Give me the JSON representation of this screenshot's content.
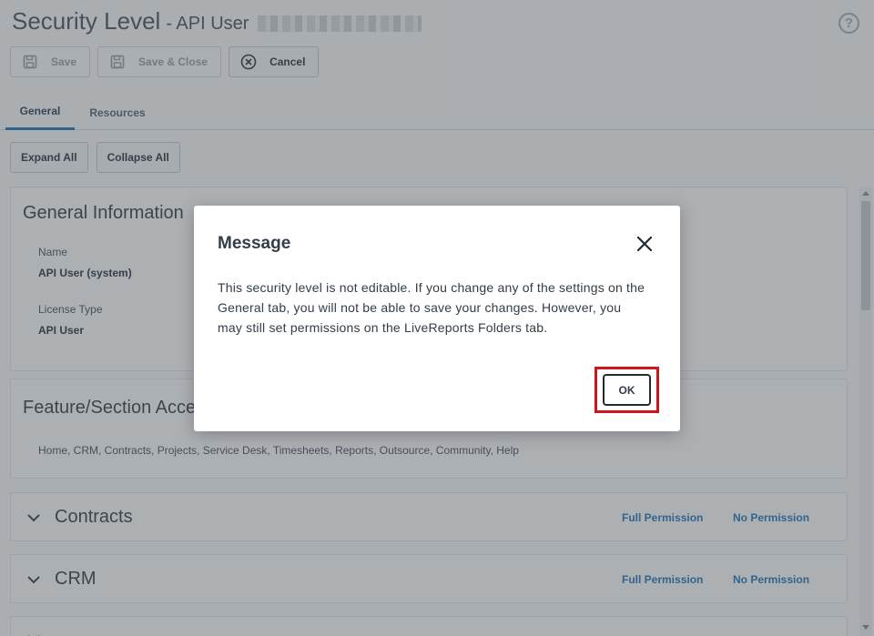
{
  "header": {
    "title": "Security Level",
    "subtitle": "- API User",
    "help_icon": "?"
  },
  "toolbar": {
    "save_label": "Save",
    "save_close_label": "Save & Close",
    "cancel_label": "Cancel"
  },
  "tabs": [
    {
      "label": "General",
      "active": true
    },
    {
      "label": "Resources",
      "active": false
    }
  ],
  "actions": {
    "expand_all": "Expand All",
    "collapse_all": "Collapse All"
  },
  "general_info": {
    "title": "General Information",
    "name_label": "Name",
    "name_value": "API User (system)",
    "license_label": "License Type",
    "license_value": "API User"
  },
  "feature_access": {
    "title": "Feature/Section Access",
    "list": "Home, CRM, Contracts, Projects, Service Desk, Timesheets, Reports, Outsource, Community, Help"
  },
  "sections": [
    {
      "title": "Contracts",
      "full": "Full Permission",
      "none": "No Permission"
    },
    {
      "title": "CRM",
      "full": "Full Permission",
      "none": "No Permission"
    }
  ],
  "dialog": {
    "title": "Message",
    "body": "This security level is not editable. If you change any of the settings on the General tab, you will not be able to save your changes. However, you may still set permissions on the LiveReports Folders tab.",
    "ok_label": "OK"
  },
  "colors": {
    "accent": "#2a7bbd",
    "highlight": "#d0141e",
    "overlay": "#3c424a"
  }
}
